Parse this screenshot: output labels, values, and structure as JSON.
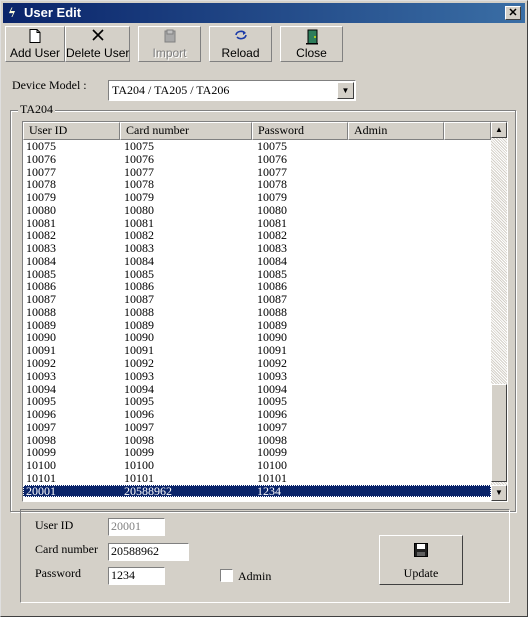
{
  "window": {
    "title": "User Edit"
  },
  "toolbar": {
    "buttons": [
      {
        "label": "Add User",
        "icon": "new-page-icon"
      },
      {
        "label": "Delete User",
        "icon": "x-icon"
      },
      {
        "label": "Import",
        "icon": "import-icon",
        "disabled": true
      },
      {
        "label": "Reload",
        "icon": "reload-icon"
      },
      {
        "label": "Close",
        "icon": "door-exit-icon"
      }
    ]
  },
  "device": {
    "label": "Device Model :",
    "value": "TA204 / TA205 / TA206"
  },
  "group": {
    "label": "TA204"
  },
  "grid": {
    "columns": [
      "User ID",
      "Card number",
      "Password",
      "Admin"
    ],
    "rows": [
      [
        "10075",
        "10075",
        "10075",
        ""
      ],
      [
        "10076",
        "10076",
        "10076",
        ""
      ],
      [
        "10077",
        "10077",
        "10077",
        ""
      ],
      [
        "10078",
        "10078",
        "10078",
        ""
      ],
      [
        "10079",
        "10079",
        "10079",
        ""
      ],
      [
        "10080",
        "10080",
        "10080",
        ""
      ],
      [
        "10081",
        "10081",
        "10081",
        ""
      ],
      [
        "10082",
        "10082",
        "10082",
        ""
      ],
      [
        "10083",
        "10083",
        "10083",
        ""
      ],
      [
        "10084",
        "10084",
        "10084",
        ""
      ],
      [
        "10085",
        "10085",
        "10085",
        ""
      ],
      [
        "10086",
        "10086",
        "10086",
        ""
      ],
      [
        "10087",
        "10087",
        "10087",
        ""
      ],
      [
        "10088",
        "10088",
        "10088",
        ""
      ],
      [
        "10089",
        "10089",
        "10089",
        ""
      ],
      [
        "10090",
        "10090",
        "10090",
        ""
      ],
      [
        "10091",
        "10091",
        "10091",
        ""
      ],
      [
        "10092",
        "10092",
        "10092",
        ""
      ],
      [
        "10093",
        "10093",
        "10093",
        ""
      ],
      [
        "10094",
        "10094",
        "10094",
        ""
      ],
      [
        "10095",
        "10095",
        "10095",
        ""
      ],
      [
        "10096",
        "10096",
        "10096",
        ""
      ],
      [
        "10097",
        "10097",
        "10097",
        ""
      ],
      [
        "10098",
        "10098",
        "10098",
        ""
      ],
      [
        "10099",
        "10099",
        "10099",
        ""
      ],
      [
        "10100",
        "10100",
        "10100",
        ""
      ],
      [
        "10101",
        "10101",
        "10101",
        ""
      ],
      [
        "20001",
        "20588962",
        "1234",
        ""
      ]
    ],
    "selected_row": 27
  },
  "form": {
    "user_id_label": "User ID",
    "user_id": "20001",
    "card_label": "Card number",
    "card": "20588962",
    "password_label": "Password",
    "password": "1234",
    "admin_label": "Admin",
    "admin_checked": false,
    "update_label": "Update",
    "update_icon": "floppy-disk-icon"
  },
  "colors": {
    "title_bar": "#0a246a",
    "selection": "#0a246a",
    "face": "#d4d0c8"
  }
}
